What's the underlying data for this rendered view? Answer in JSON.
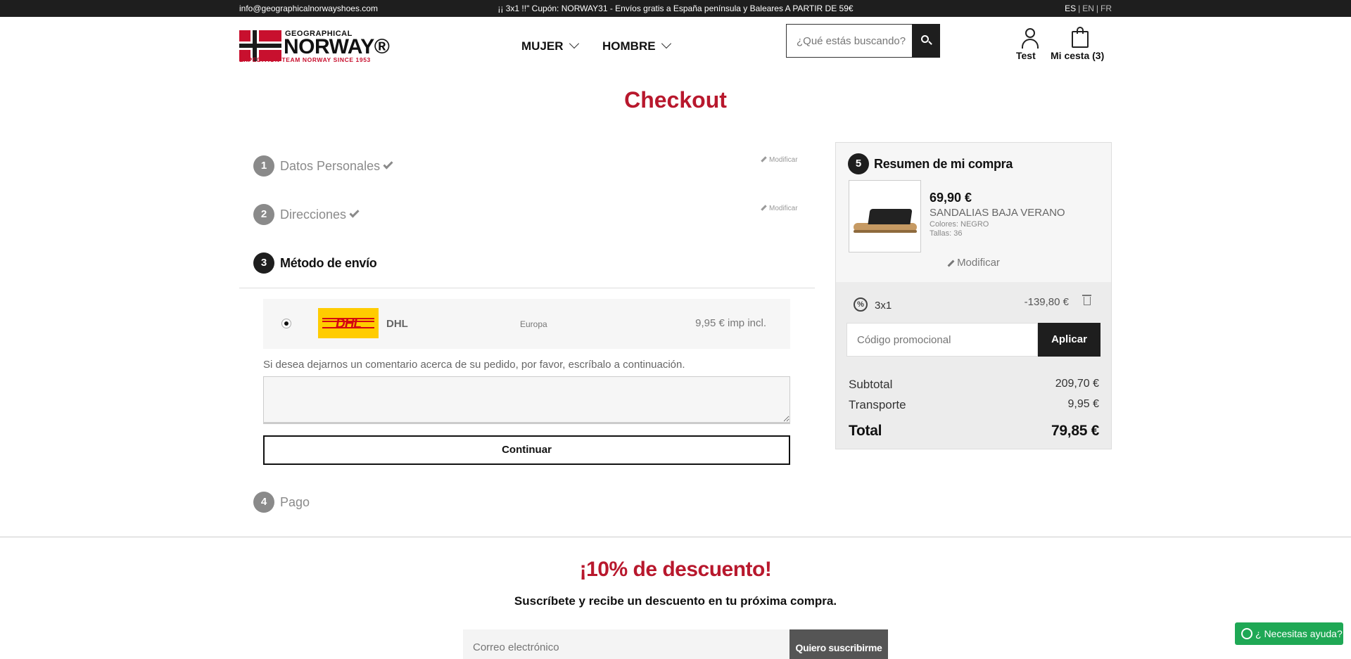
{
  "topbar": {
    "email": "info@geographicalnorwayshoes.com",
    "promo": "¡¡ 3x1 !!\" Cupón: NORWAY31 - Envíos gratis a España península y Baleares A PARTIR DE 59€",
    "langs": [
      "ES",
      "EN",
      "FR"
    ],
    "active_lang": "ES"
  },
  "logo": {
    "top": "GEOGRAPHICAL",
    "main": "NORWAY®",
    "tagline": "EXPEDITION TEAM NORWAY SINCE 1953"
  },
  "nav": {
    "items": [
      "MUJER",
      "HOMBRE"
    ]
  },
  "search": {
    "placeholder": "¿Qué estás buscando?"
  },
  "header": {
    "account_label": "Test",
    "cart_label": "Mi cesta (3)"
  },
  "page": {
    "title": "Checkout"
  },
  "steps": [
    {
      "num": "1",
      "label": "Datos Personales",
      "modify": "Modificar"
    },
    {
      "num": "2",
      "label": "Direcciones",
      "modify": "Modificar"
    },
    {
      "num": "3",
      "label": "Método de envío"
    },
    {
      "num": "4",
      "label": "Pago"
    }
  ],
  "shipping": {
    "carrier_logo": "DHL",
    "name": "DHL",
    "zone": "Europa",
    "price": "9,95 € imp incl."
  },
  "comment": {
    "label": "Si desea dejarnos un comentario acerca de su pedido, por favor, escríbalo a continuación.",
    "value": ""
  },
  "continue_label": "Continuar",
  "summary": {
    "num": "5",
    "title": "Resumen de mi compra",
    "product": {
      "price": "69,90 €",
      "name": "SANDALIAS BAJA VERANO",
      "colors": "Colores: NEGRO",
      "sizes": "Tallas: 36"
    },
    "modify_label": "Modificar",
    "discount": {
      "label": "3x1",
      "value": "-139,80 €"
    },
    "promo_placeholder": "Código promocional",
    "promo_button": "Aplicar",
    "subtotal_label": "Subtotal",
    "subtotal_value": "209,70 €",
    "shipping_label": "Transporte",
    "shipping_value": "9,95 €",
    "total_label": "Total",
    "total_value": "79,85 €"
  },
  "newsletter": {
    "title": "¡10% de descuento!",
    "subtitle": "Suscríbete y recibe un descuento en tu próxima compra.",
    "placeholder": "Correo electrónico",
    "button": "Quiero suscribirme"
  },
  "whatsapp": {
    "label": "¿ Necesitas ayuda?"
  },
  "colors": {
    "accent_red": "#b8182d",
    "dark": "#1e1e1e",
    "whatsapp_green": "#1fa855"
  }
}
